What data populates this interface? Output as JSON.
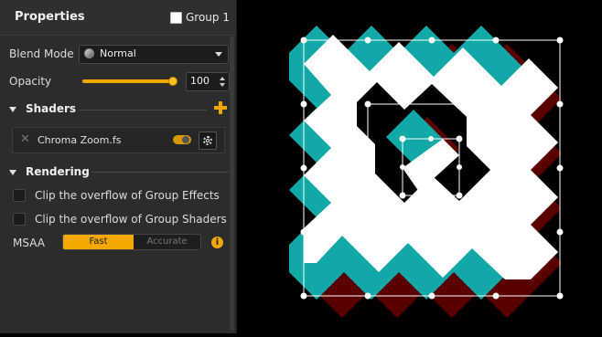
{
  "panel": {
    "title": "Properties",
    "group_label": "Group 1",
    "group_checked": true
  },
  "blend": {
    "label": "Blend Mode",
    "value": "Normal"
  },
  "opacity": {
    "label": "Opacity",
    "value": "100",
    "level": 1.0
  },
  "shaders": {
    "heading": "Shaders",
    "items": [
      {
        "name": "Chroma Zoom.fs",
        "enabled": true
      }
    ]
  },
  "rendering": {
    "heading": "Rendering",
    "clip_effects_label": "Clip the overflow of Group Effects",
    "clip_shaders_label": "Clip the overflow of Group Shaders",
    "msaa_label": "MSAA",
    "msaa_options": [
      "Fast",
      "Accurate"
    ],
    "msaa_selected": "Fast"
  },
  "colors": {
    "accent": "#f5a900",
    "panel_bg": "#2c2c2c",
    "teal": "#12a8a8",
    "maroon": "#5a0000",
    "white": "#ffffff"
  },
  "icons": [
    "blend-mode-icon",
    "dropdown-arrow-icon",
    "add-shader-icon",
    "remove-shader-icon",
    "gear-icon",
    "info-icon"
  ]
}
